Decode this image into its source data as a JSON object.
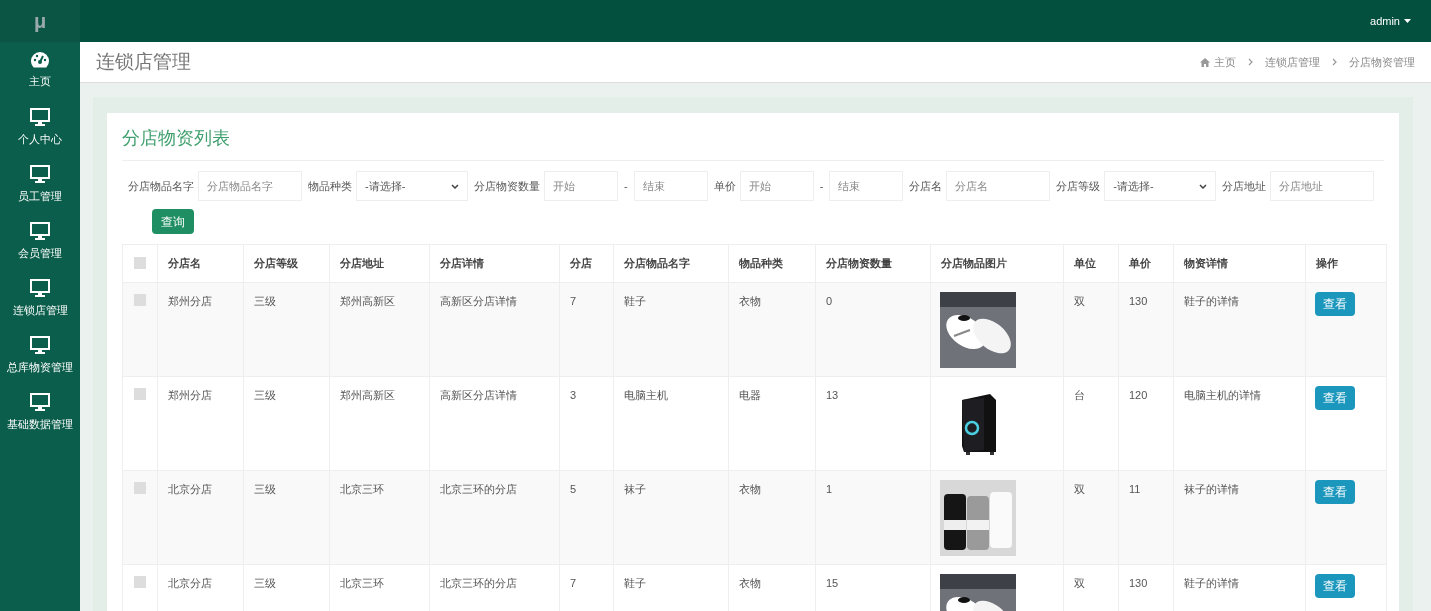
{
  "logo": "μ",
  "sidebar": {
    "items": [
      {
        "label": "主页"
      },
      {
        "label": "个人中心"
      },
      {
        "label": "员工管理"
      },
      {
        "label": "会员管理"
      },
      {
        "label": "连锁店管理"
      },
      {
        "label": "总库物资管理"
      },
      {
        "label": "基础数据管理"
      }
    ]
  },
  "topbar": {
    "user": "admin"
  },
  "page_title": "连锁店管理",
  "breadcrumb": [
    "主页",
    "连锁店管理",
    "分店物资管理"
  ],
  "card_title": "分店物资列表",
  "filters": [
    {
      "kind": "text",
      "label": "分店物品名字",
      "placeholder": "分店物品名字"
    },
    {
      "kind": "select",
      "label": "物品种类",
      "value": "-请选择-"
    },
    {
      "kind": "range",
      "label": "分店物资数量",
      "placeholders": [
        "开始",
        "结束"
      ],
      "separator": "-"
    },
    {
      "kind": "range",
      "label": "单价",
      "placeholders": [
        "开始",
        "结束"
      ],
      "separator": "-"
    },
    {
      "kind": "text",
      "label": "分店名",
      "placeholder": "分店名"
    },
    {
      "kind": "select",
      "label": "分店等级",
      "value": "-请选择-"
    },
    {
      "kind": "text",
      "label": "分店地址",
      "placeholder": "分店地址"
    }
  ],
  "search_button": "查询",
  "table": {
    "select_all_checked": false,
    "columns": [
      "分店名",
      "分店等级",
      "分店地址",
      "分店详情",
      "分店",
      "分店物品名字",
      "物品种类",
      "分店物资数量",
      "分店物品图片",
      "单位",
      "单价",
      "物资详情",
      "操作"
    ],
    "rows": [
      {
        "checked": false,
        "cells": [
          "郑州分店",
          "三级",
          "郑州高新区",
          "高新区分店详情",
          "7",
          "鞋子",
          "衣物",
          "0",
          {
            "kind": "picture"
          },
          "双",
          "130",
          "鞋子的详情"
        ],
        "action": "查看"
      },
      {
        "checked": false,
        "cells": [
          "郑州分店",
          "三级",
          "郑州高新区",
          "高新区分店详情",
          "3",
          "电脑主机",
          "电器",
          "13",
          {
            "kind": "picture"
          },
          "台",
          "120",
          "电脑主机的详情"
        ],
        "action": "查看"
      },
      {
        "checked": false,
        "cells": [
          "北京分店",
          "三级",
          "北京三环",
          "北京三环的分店",
          "5",
          "袜子",
          "衣物",
          "1",
          {
            "kind": "picture"
          },
          "双",
          "11",
          "袜子的详情"
        ],
        "action": "查看"
      },
      {
        "checked": false,
        "cells": [
          "北京分店",
          "三级",
          "北京三环",
          "北京三环的分店",
          "7",
          "鞋子",
          "衣物",
          "15",
          {
            "kind": "picture"
          },
          "双",
          "130",
          "鞋子的详情"
        ],
        "action": "查看"
      }
    ]
  }
}
